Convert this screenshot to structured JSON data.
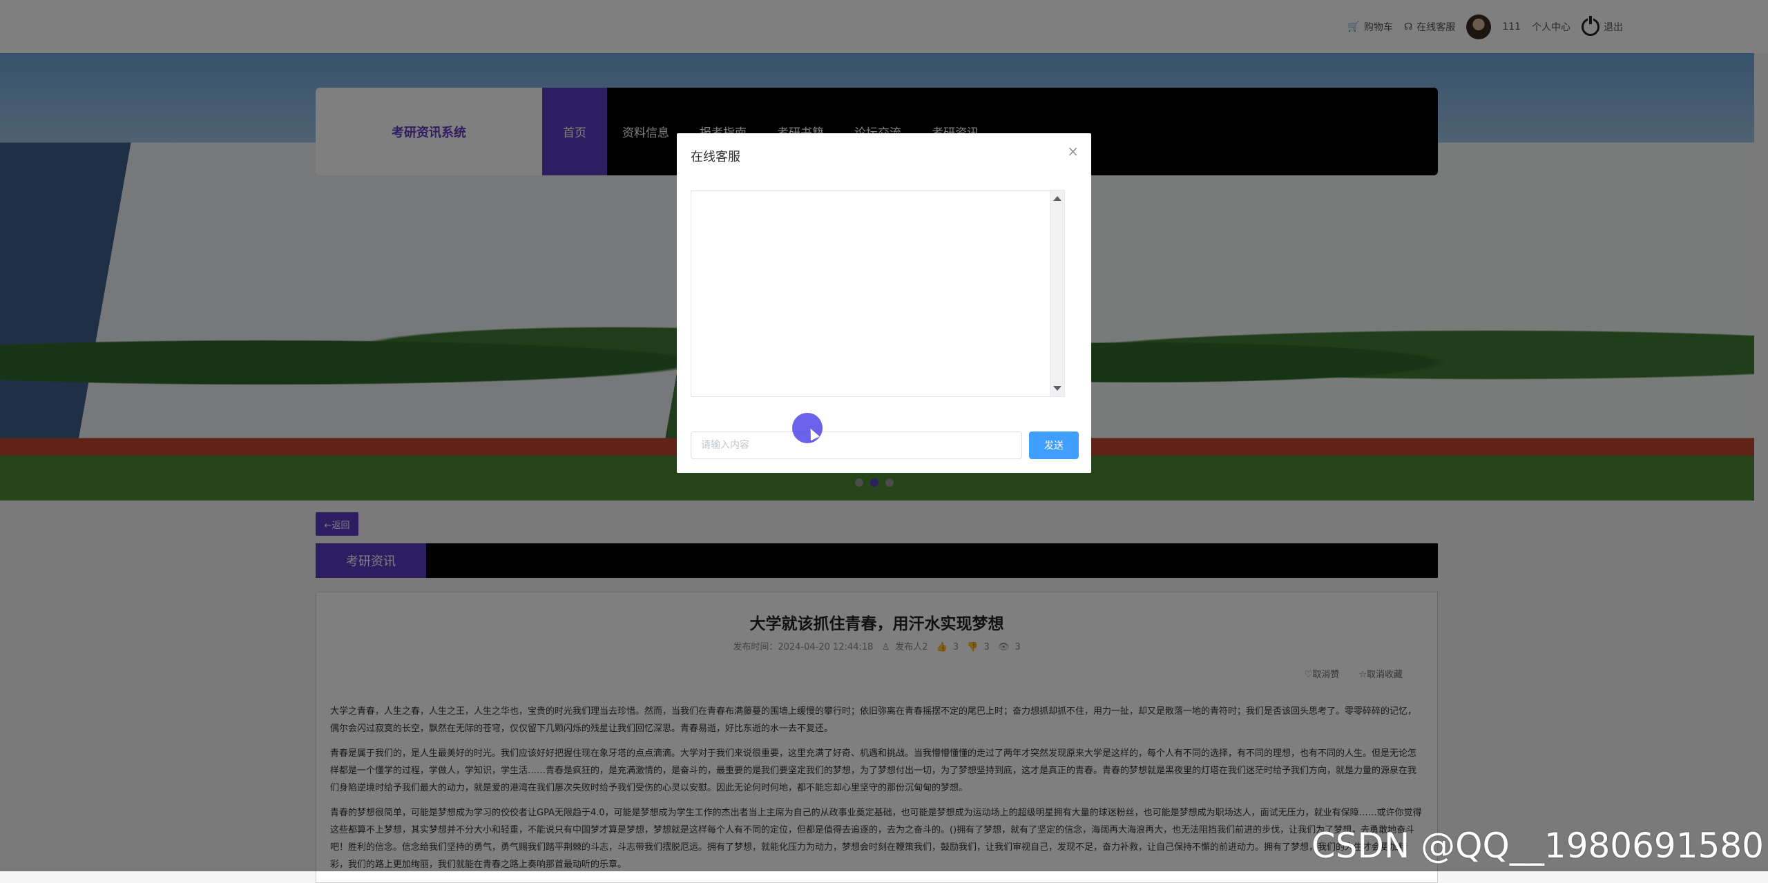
{
  "header": {
    "cart_label": "购物车",
    "support_label": "在线客服",
    "username": "111",
    "profile_label": "个人中心",
    "logout_label": "退出"
  },
  "nav": {
    "logo": "考研资讯系统",
    "items": [
      "首页",
      "资料信息",
      "报考指南",
      "考研书籍",
      "论坛交流",
      "考研资讯"
    ],
    "active_index": 0
  },
  "dialog": {
    "title": "在线客服",
    "close": "×",
    "input_placeholder": "请输入内容",
    "send_label": "发送"
  },
  "content": {
    "back_label": "←返回",
    "section_title": "考研资讯",
    "article": {
      "title": "大学就该抓住青春，用汗水实现梦想",
      "publish_time": "发布时间：2024-04-20 12:44:18",
      "author": "发布人2",
      "likes": "3",
      "dislikes": "3",
      "views": "3",
      "unlike_label": "取消赞",
      "unfav_label": "取消收藏",
      "paragraphs": [
        "大学之青春，人生之春，人生之王，人生之华也，宝贵的时光我们理当去珍惜。然而，当我们在青春布满藤蔓的围墙上缓慢的攀行时；依旧弥离在青春摇摆不定的尾巴上时；奋力想抓却抓不住，用力一扯，却又是散落一地的青符时；我们是否该回头思考了。零零碎碎的记忆，偶尔会闪过寂寞的长空，飘然在无际的苍穹，仅仅留下几颗闪烁的残星让我们回忆深思。青春易逝，好比东逝的水一去不复还。",
        "青春是属于我们的，是人生最美好的时光。我们应该好好把握住现在象牙塔的点点滴滴。大学对于我们来说很重要，这里充满了好奇、机遇和挑战。当我懵懵懂懂的走过了两年才突然发现原来大学是这样的，每个人有不同的选择，有不同的理想，也有不同的人生。但是无论怎样都是一个懂学的过程，学做人，学知识，学生活……青春是疯狂的，是充满激情的，是奋斗的，最重要的是我们要坚定我们的梦想，为了梦想付出一切，为了梦想坚持到底，这才是真正的青春。青春的梦想就是黑夜里的灯塔在我们迷茫时给予我们方向，就是力量的源泉在我们身陷逆境时给予我们最大的动力，就是爱的港湾在我们屡次失败时给予我们受伤的心灵以安慰。因此无论何时何地，都不能忘却心里坚守的那份沉甸甸的梦想。",
        "青春的梦想很简单，可能是梦想成为学习的佼佼者让GPA无限趋于4.0，可能是梦想成为学生工作的杰出者当上主席为自己的从政事业奠定基础，也可能是梦想成为运动场上的超级明星拥有大量的球迷粉丝，也可能是梦想成为职场达人，面试无压力，就业有保障……或许你觉得这些都算不上梦想，其实梦想并不分大小和轻重，不能说只有中国梦才算是梦想，梦想就是这样每个人有不同的定位，但都是值得去追逐的，去为之奋斗的。()拥有了梦想，就有了坚定的信念，海阔再大海浪再大，也无法阻挡我们前进的步伐，让我们为了梦想，去勇敢地奋斗吧！胜利的信念。信念给我们坚持的勇气，勇气赐我们踏平荆棘的斗志，斗志带我们摆脱厄运。拥有了梦想，就能化压力为动力，梦想会时刻在鞭策我们，鼓励我们，让我们审视自己，发现不足，奋力补救，让自己保持不懈的前进动力。拥有了梦想，我们的人生才会更加精彩，我们的路上更加绚丽，我们就能在青春之路上奏响那首最动听的乐章。"
      ]
    }
  },
  "watermark": "CSDN @QQ__1980691580"
}
